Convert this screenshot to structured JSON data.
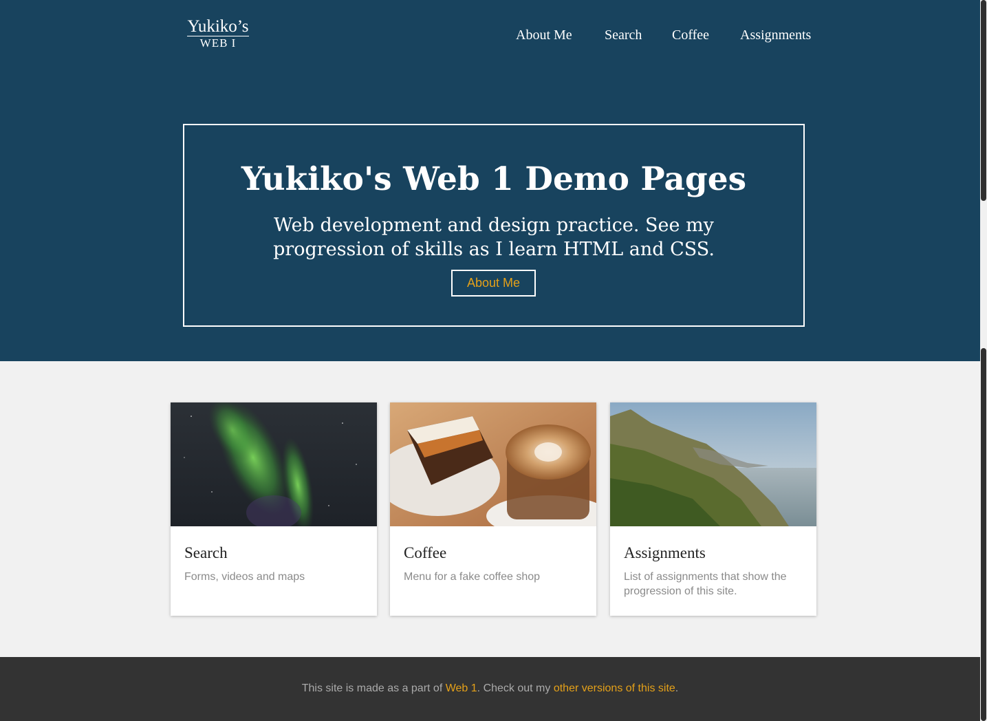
{
  "logo": {
    "line1": "Yukiko’s",
    "line2": "WEB I"
  },
  "nav": [
    {
      "label": "About Me"
    },
    {
      "label": "Search"
    },
    {
      "label": "Coffee"
    },
    {
      "label": "Assignments"
    }
  ],
  "hero": {
    "title": "Yukiko's Web 1 Demo Pages",
    "subtitle": "Web development and design practice. See my progression of skills as I learn HTML and CSS.",
    "button_label": "About Me"
  },
  "cards": [
    {
      "title": "Search",
      "description": "Forms, videos and maps"
    },
    {
      "title": "Coffee",
      "description": "Menu for a fake coffee shop"
    },
    {
      "title": "Assignments",
      "description": "List of assignments that show the progression of this site."
    }
  ],
  "footer": {
    "text_before": "This site is made as a part of ",
    "link1": "Web 1",
    "text_middle": ". Check out my ",
    "link2": "other versions of this site",
    "text_after": "."
  },
  "colors": {
    "hero_background": "#18435e",
    "accent": "#e5a119",
    "page_background": "#f1f1f1",
    "footer_background": "#333333"
  }
}
